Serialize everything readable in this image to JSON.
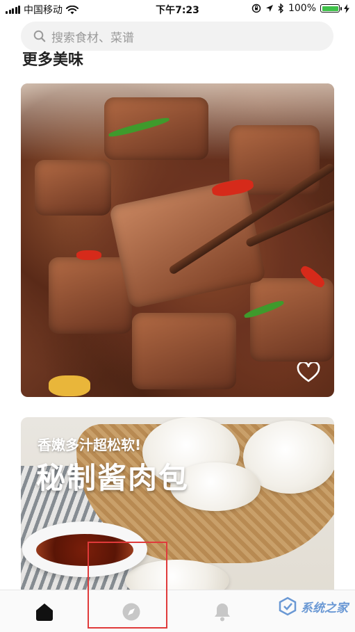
{
  "status_bar": {
    "carrier": "中国移动",
    "time": "下午7:23",
    "battery": "100%",
    "battery_level": 1.0
  },
  "search": {
    "placeholder": "搜索食材、菜谱",
    "icon": "search-icon"
  },
  "section": {
    "title": "更多美味"
  },
  "cards": [
    {
      "id": "card-1",
      "image": "braised pork ribs with chopsticks",
      "favorite_icon": "heart-icon"
    },
    {
      "id": "card-2",
      "image": "steamed buns in basket",
      "tagline": "香嫩多汁超松软!",
      "headline": "秘制酱肉包"
    }
  ],
  "tab_bar": {
    "items": [
      {
        "icon": "home-icon",
        "active": true
      },
      {
        "icon": "compass-icon",
        "active": false
      },
      {
        "icon": "bell-icon",
        "active": false
      }
    ]
  },
  "annotation": {
    "highlight_color": "#e03a3a"
  },
  "watermark": {
    "text": "系统之家"
  },
  "colors": {
    "battery": "#3fc24a",
    "search_bg": "#f2f2f2",
    "watermark": "#3a78c8"
  }
}
